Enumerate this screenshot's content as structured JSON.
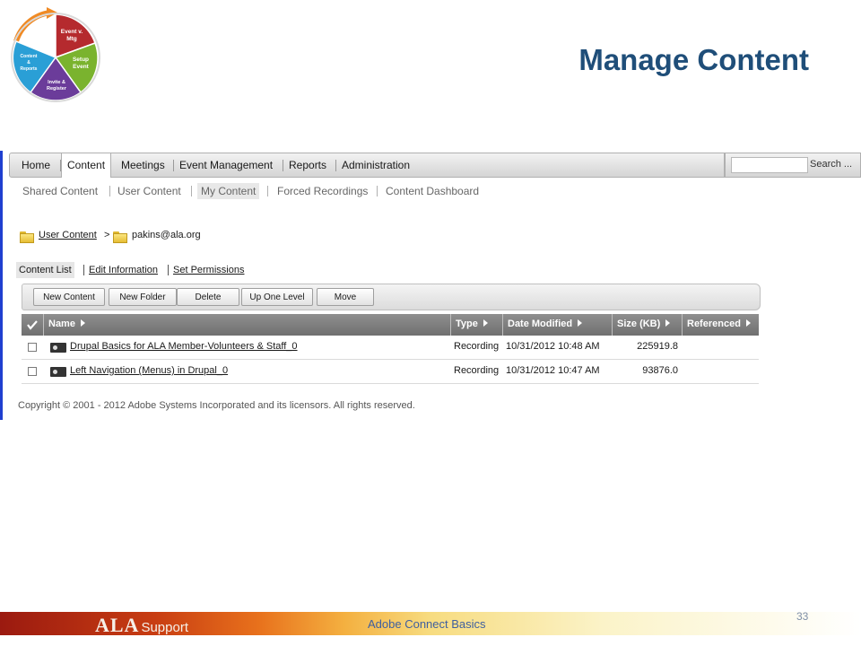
{
  "slide": {
    "title": "Manage Content",
    "footer_text": "Adobe Connect Basics",
    "page_number": "33",
    "logo_text": "ALA",
    "logo_subtext": "Support"
  },
  "cycle": {
    "segments": [
      {
        "line1": "Event v.",
        "line2": "Mtg",
        "color": "#b52a2e"
      },
      {
        "line1": "Setup",
        "line2": "Event",
        "color": "#7ab32e"
      },
      {
        "line1": "Invite &",
        "line2": "Register",
        "color": "#6b3c9a"
      },
      {
        "line1": "Content",
        "line2": "&",
        "line3": "Reports",
        "color": "#2a9fd6"
      }
    ],
    "arrow_color": "#f08a24"
  },
  "main_nav": {
    "items": [
      "Home",
      "Content",
      "Meetings",
      "Event Management",
      "Reports",
      "Administration"
    ],
    "active": "Content"
  },
  "search": {
    "value": "",
    "label": "Search ..."
  },
  "sub_nav": {
    "items": [
      "Shared Content",
      "User Content",
      "My Content",
      "Forced Recordings",
      "Content Dashboard"
    ],
    "active": "My Content"
  },
  "breadcrumb": {
    "parent": "User Content",
    "separator": ">",
    "current": "pakins@ala.org"
  },
  "content_tabs": {
    "items": [
      "Content List",
      "Edit Information",
      "Set Permissions"
    ],
    "active": "Content List"
  },
  "toolbar": {
    "buttons": [
      "New Content",
      "New Folder",
      "Delete",
      "Up One Level",
      "Move"
    ]
  },
  "table": {
    "check_all": "✓",
    "columns": [
      "Name",
      "Type",
      "Date Modified",
      "Size (KB)",
      "Referenced"
    ],
    "rows": [
      {
        "name": "Drupal Basics for ALA Member-Volunteers & Staff_0",
        "type": "Recording",
        "date": "10/31/2012 10:48 AM",
        "size": "225919.8",
        "referenced": ""
      },
      {
        "name": "Left Navigation (Menus) in Drupal_0",
        "type": "Recording",
        "date": "10/31/2012 10:47 AM",
        "size": "93876.0",
        "referenced": ""
      }
    ]
  },
  "copyright": "Copyright © 2001 - 2012 Adobe Systems Incorporated and its licensors. All rights reserved."
}
